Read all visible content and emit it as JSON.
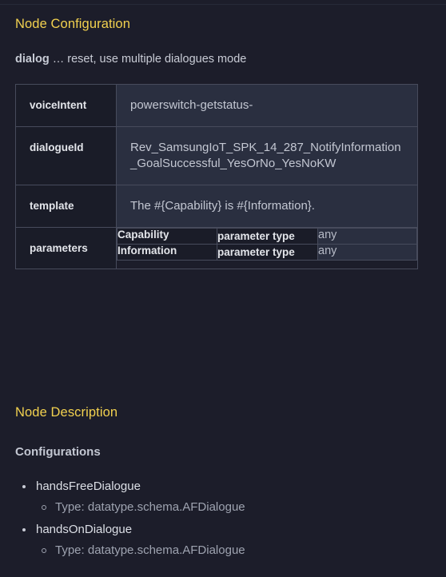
{
  "theme": {
    "background": "#1c1d2a",
    "heading_accent": "#f2d14f",
    "body_text": "#c9ccd6",
    "table_border": "#474b5c",
    "label_cell_bg": "#1a1c28",
    "value_cell_bg": "#2a2f40"
  },
  "config_section": {
    "heading": "Node Configuration",
    "intro": {
      "keyword": "dialog",
      "rest": " … reset, use multiple dialogues mode"
    },
    "table": {
      "rows": [
        {
          "label": "voiceIntent",
          "value": "powerswitch-getstatus-"
        },
        {
          "label": "dialogueId",
          "value": "Rev_SamsungIoT_SPK_14_287_NotifyInformation_GoalSuccessful_YesOrNo_YesNoKW"
        },
        {
          "label": "template",
          "value": "The #{Capability} is #{Information}."
        }
      ],
      "parameters": {
        "label": "parameters",
        "items": [
          {
            "name": "Capability",
            "type_label": "parameter type",
            "type_value": "any"
          },
          {
            "name": "Information",
            "type_label": "parameter type",
            "type_value": "any"
          }
        ]
      }
    }
  },
  "description_section": {
    "heading": "Node Description",
    "subheading": "Configurations",
    "items": [
      {
        "name": "handsFreeDialogue",
        "detail": "Type: datatype.schema.AFDialogue"
      },
      {
        "name": "handsOnDialogue",
        "detail": "Type: datatype.schema.AFDialogue"
      }
    ]
  }
}
